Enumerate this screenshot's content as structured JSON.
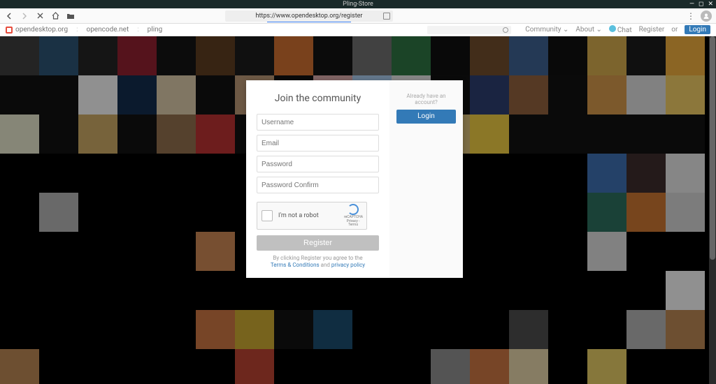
{
  "window": {
    "title": "Pling-Store"
  },
  "browser": {
    "url": "https://www.opendesktop.org/register"
  },
  "topnav": {
    "sites": [
      "opendesktop.org",
      "opencode.net",
      "pling"
    ],
    "menu": {
      "community": "Community",
      "about": "About",
      "chat": "Chat",
      "register": "Register",
      "or": "or",
      "login": "Login"
    }
  },
  "card": {
    "title": "Join the community",
    "placeholders": {
      "username": "Username",
      "email": "Email",
      "password": "Password",
      "password_confirm": "Password Confirm"
    },
    "recaptcha": {
      "label": "I'm not a robot",
      "brand": "reCAPTCHA",
      "legal": "Privacy - Terms"
    },
    "register_button": "Register",
    "fineprint": {
      "lead": "By clicking Register you agree to the",
      "terms": "Terms & Conditions",
      "and": "and",
      "privacy": "privacy policy"
    },
    "side": {
      "already": "Already have an account?",
      "login": "Login"
    }
  },
  "avatar_colors": [
    [
      "#3a3a3a",
      "#2b4f6e",
      "#222",
      "#8a1f2e",
      "#141414",
      "#5a3b1f",
      "#1b1b1b",
      "#c46a2e",
      "#121212",
      "#6a6a6a",
      "#2c6e3f",
      "#0f0f0f",
      "#6b4a2a",
      "#3b5c8a",
      "#101010",
      "#c9a24a",
      "#1a1a1a",
      "#e0a43a"
    ],
    [
      "#111",
      "#111",
      "#e8e8e8",
      "#122a4a",
      "#cfbfa0",
      "#111",
      "#b09070",
      "#111",
      "#cda0a0",
      "#a0c0e0",
      "#d8d8d8",
      "#111",
      "#2a3a6a",
      "#8a5c3a",
      "#111",
      "#c89048",
      "#d0d0d0",
      "#e2c060"
    ],
    [
      "#d8d8c0",
      "#111",
      "#c0a060",
      "#111",
      "#8a6a4a",
      "#b03030",
      "#111",
      "#111",
      "#111",
      "#111",
      "#111",
      "#c8b070",
      "#e0c040",
      "#111",
      "#111",
      "#111",
      "#111",
      "#111"
    ],
    [
      "#000",
      "#000",
      "#000",
      "#000",
      "#000",
      "#000",
      "#000",
      "#000",
      "#000",
      "#000",
      "#000",
      "#000",
      "#000",
      "#000",
      "#000",
      "#3a6aa8",
      "#3a2a2a",
      "#d8d8d8"
    ],
    [
      "#000",
      "#aaa",
      "#000",
      "#000",
      "#000",
      "#000",
      "#000",
      "#000",
      "#000",
      "#000",
      "#000",
      "#000",
      "#000",
      "#000",
      "#000",
      "#2a6a5a",
      "#c07030",
      "#c8c8c8"
    ],
    [
      "#000",
      "#000",
      "#000",
      "#000",
      "#000",
      "#c08050",
      "#000",
      "#000",
      "#000",
      "#000",
      "#000",
      "#000",
      "#000",
      "#000",
      "#000",
      "#d0d0d0",
      "#000",
      "#000"
    ],
    [
      "#000",
      "#000",
      "#000",
      "#000",
      "#000",
      "#000",
      "#000",
      "#000",
      "#000",
      "#000",
      "#000",
      "#000",
      "#000",
      "#000",
      "#000",
      "#000",
      "#000",
      "#e8e8e8"
    ],
    [
      "#000",
      "#000",
      "#000",
      "#000",
      "#000",
      "#c07040",
      "#c0a030",
      "#111",
      "#1a4a6a",
      "#000",
      "#000",
      "#000",
      "#000",
      "#4a4a4a",
      "#000",
      "#000",
      "#aaa",
      "#b08050"
    ],
    [
      "#b08050",
      "#000",
      "#000",
      "#000",
      "#000",
      "#000",
      "#b04030",
      "#000",
      "#000",
      "#000",
      "#000",
      "#888",
      "#c07040",
      "#d8c8a0",
      "#000",
      "#d8c060",
      "#000",
      "#000"
    ]
  ]
}
